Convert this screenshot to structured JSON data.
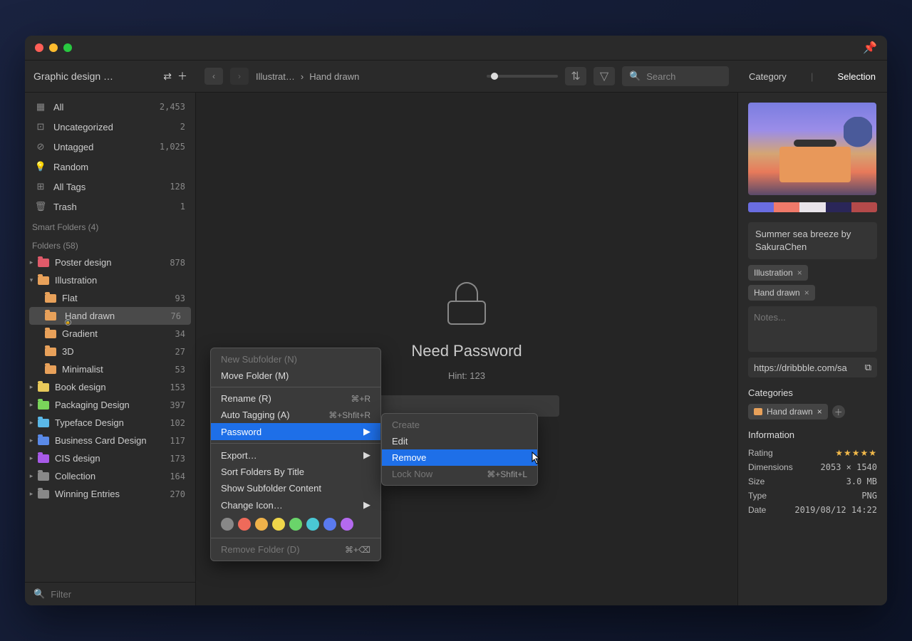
{
  "titlebar": {
    "close": "●",
    "min": "●",
    "max": "●"
  },
  "toolbar": {
    "library": "Graphic design …",
    "breadcrumb": [
      "Illustrat…",
      "Hand drawn"
    ],
    "search_placeholder": "Search",
    "right_category": "Category",
    "right_selection": "Selection"
  },
  "sidebar": {
    "quick": [
      {
        "name": "All",
        "count": "2,453"
      },
      {
        "name": "Uncategorized",
        "count": "2"
      },
      {
        "name": "Untagged",
        "count": "1,025"
      },
      {
        "name": "Random",
        "count": ""
      },
      {
        "name": "All Tags",
        "count": "128"
      },
      {
        "name": "Trash",
        "count": "1"
      }
    ],
    "smart_header": "Smart Folders (4)",
    "folders_header": "Folders (58)",
    "folders": [
      {
        "name": "Poster design",
        "count": "878",
        "color": "#e05a6a"
      },
      {
        "name": "Illustration",
        "count": "",
        "color": "#e8a15a",
        "open": true,
        "children": [
          {
            "name": "Flat",
            "count": "93"
          },
          {
            "name": "Hand drawn",
            "count": "76",
            "selected": true,
            "locked": true
          },
          {
            "name": "Gradient",
            "count": "34"
          },
          {
            "name": "3D",
            "count": "27"
          },
          {
            "name": "Minimalist",
            "count": "53"
          }
        ]
      },
      {
        "name": "Book design",
        "count": "153",
        "color": "#e8c95a"
      },
      {
        "name": "Packaging Design",
        "count": "397",
        "color": "#7ad45a"
      },
      {
        "name": "Typeface Design",
        "count": "102",
        "color": "#5ab8e8"
      },
      {
        "name": "Business Card Design",
        "count": "117",
        "color": "#5a8ae8"
      },
      {
        "name": "CIS design",
        "count": "173",
        "color": "#a85ae8"
      },
      {
        "name": "Collection",
        "count": "164",
        "color": "#888"
      },
      {
        "name": "Winning Entries",
        "count": "270",
        "color": "#888"
      }
    ],
    "filter_placeholder": "Filter"
  },
  "main": {
    "heading": "Need Password",
    "hint": "Hint: 123"
  },
  "inspector": {
    "title": "Summer sea breeze by SakuraChen",
    "tags": [
      "Illustration",
      "Hand drawn"
    ],
    "notes_placeholder": "Notes...",
    "url": "https://dribbble.com/sa",
    "categories_header": "Categories",
    "category_tag": "Hand drawn",
    "info_header": "Information",
    "info": {
      "rating_label": "Rating",
      "rating_value": "★★★★★",
      "dim_label": "Dimensions",
      "dim_value": "2053 × 1540",
      "size_label": "Size",
      "size_value": "3.0 MB",
      "type_label": "Type",
      "type_value": "PNG",
      "date_label": "Date",
      "date_value": "2019/08/12 14:22"
    },
    "swatches": [
      "#6a6de0",
      "#ef7a6a",
      "#e8e4ea",
      "#2a2658",
      "#b44a4a"
    ]
  },
  "context_menu": {
    "items": [
      {
        "label": "New Subfolder (N)",
        "disabled": true
      },
      {
        "label": "Move Folder (M)"
      },
      "sep",
      {
        "label": "Rename (R)",
        "shortcut": "⌘+R"
      },
      {
        "label": "Auto Tagging (A)",
        "shortcut": "⌘+Shfit+R"
      },
      {
        "label": "Password",
        "submenu": true,
        "highlight": true
      },
      "sep",
      {
        "label": "Export…",
        "submenu": true
      },
      {
        "label": "Sort Folders By Title"
      },
      {
        "label": "Show Subfolder Content"
      },
      {
        "label": "Change Icon…",
        "submenu": true
      },
      "colors",
      "sep",
      {
        "label": "Remove Folder (D)",
        "shortcut": "⌘+⌫",
        "disabled": true
      }
    ],
    "colors": [
      "#888",
      "#ef6a5a",
      "#efb24a",
      "#efd64a",
      "#6ad46a",
      "#4ac8d4",
      "#5a7aef",
      "#b46aef"
    ],
    "submenu": [
      {
        "label": "Create",
        "disabled": true
      },
      {
        "label": "Edit"
      },
      {
        "label": "Remove",
        "highlight": true
      },
      {
        "label": "Lock Now",
        "shortcut": "⌘+Shfit+L",
        "disabled": true
      }
    ]
  }
}
